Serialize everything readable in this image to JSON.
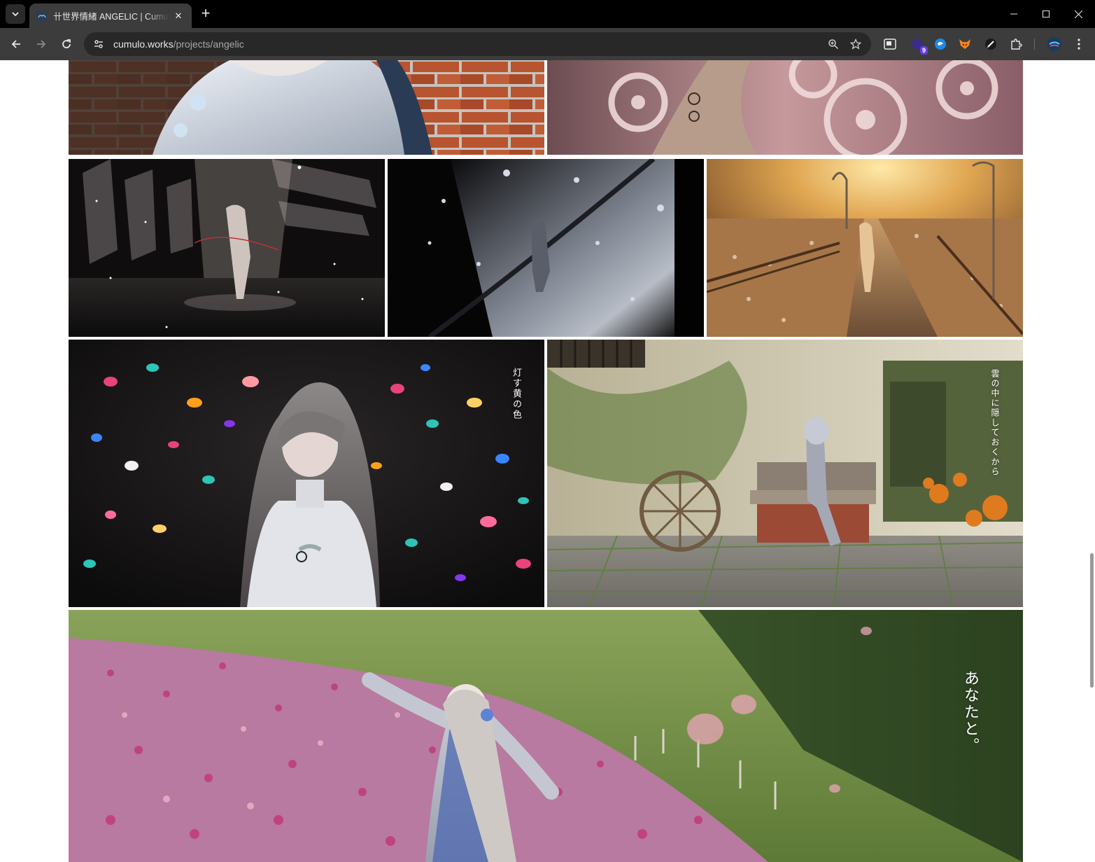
{
  "browser": {
    "tab_title": "卄世界情緒 ANGELIC | Cumulow",
    "url_host": "cumulo.works",
    "url_path": "/projects/angelic",
    "extension_badge": "9"
  },
  "gallery": {
    "captions": {
      "confetti": "灯す黄の色",
      "garden": "雲の中に隠しておくから",
      "field": "あなたと。"
    }
  }
}
